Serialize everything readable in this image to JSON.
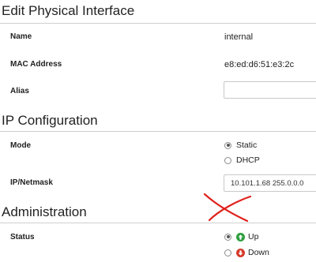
{
  "page": {
    "title": "Edit Physical Interface"
  },
  "interface": {
    "name_label": "Name",
    "name_value": "internal",
    "mac_label": "MAC Address",
    "mac_value": "e8:ed:d6:51:e3:2c",
    "alias_label": "Alias",
    "alias_value": ""
  },
  "ip_config": {
    "title": "IP Configuration",
    "mode_label": "Mode",
    "mode_options": [
      "Static",
      "DHCP"
    ],
    "mode_selected": "Static",
    "ipnetmask_label": "IP/Netmask",
    "ipnetmask_value": "10.101.1.68 255.0.0.0"
  },
  "administration": {
    "title": "Administration",
    "status_label": "Status",
    "status_options": [
      "Up",
      "Down"
    ],
    "status_selected": "Up",
    "up_icon": "arrow-up-circle-icon",
    "down_icon": "arrow-down-circle-icon"
  },
  "colors": {
    "up_green": "#2e9e3e",
    "down_red": "#d43a2b",
    "annotation_red": "#e0221e"
  }
}
